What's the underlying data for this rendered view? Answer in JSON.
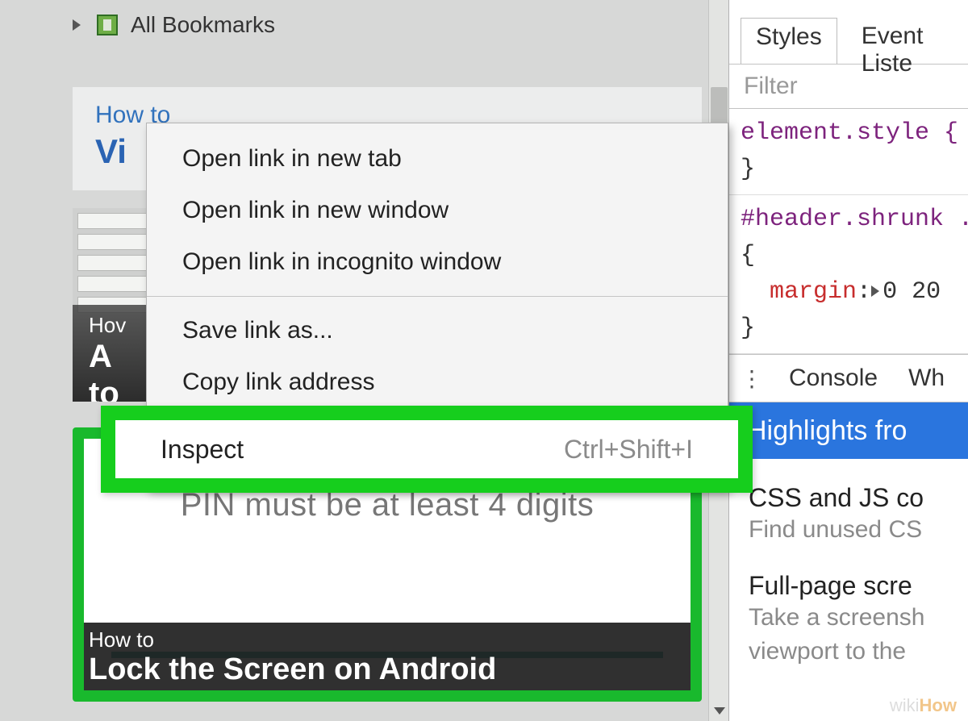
{
  "bookmarks": {
    "label": "All Bookmarks"
  },
  "articleA": {
    "howto": "How to",
    "title_visible": "Vi"
  },
  "articleB": {
    "howto": "Hov",
    "title_line1": "A",
    "title_line2": "to"
  },
  "articleC": {
    "pin_text": "PIN must be at least 4 digits",
    "howto": "How to",
    "title": "Lock the Screen on Android"
  },
  "context_menu": {
    "items_group1": [
      "Open link in new tab",
      "Open link in new window",
      "Open link in incognito window"
    ],
    "items_group2": [
      "Save link as...",
      "Copy link address"
    ],
    "highlighted": {
      "label": "Inspect",
      "shortcut": "Ctrl+Shift+I"
    }
  },
  "devtools": {
    "tabs": {
      "styles": "Styles",
      "event": "Event Liste"
    },
    "filter_placeholder": "Filter",
    "rule1": {
      "selector": "element.style {",
      "close": "}"
    },
    "rule2": {
      "selector": "#header.shrunk .",
      "open": "{",
      "prop": "margin",
      "val": "0 20",
      "close": "}"
    },
    "drawer": {
      "console": "Console",
      "other": "Wh"
    },
    "banner": "Highlights fro",
    "tips": [
      {
        "title": "CSS and JS co",
        "sub": "Find unused CS"
      },
      {
        "title": "Full-page scre",
        "sub": "Take a screensh viewport to the"
      }
    ]
  },
  "watermark": {
    "a": "wiki",
    "b": "How"
  }
}
